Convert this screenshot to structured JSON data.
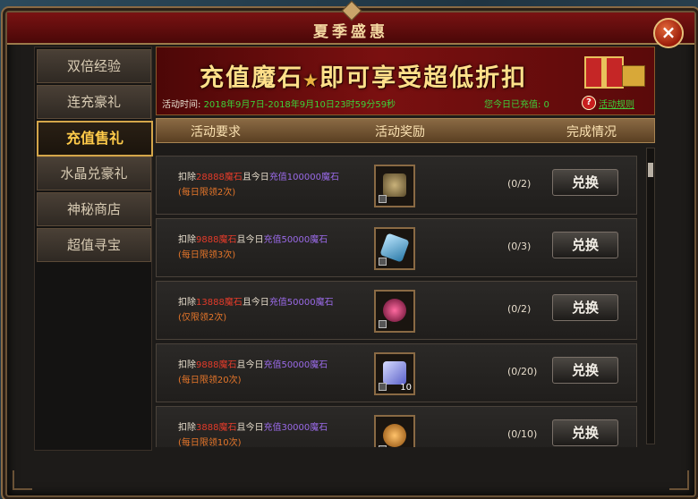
{
  "window": {
    "title": "夏季盛惠",
    "close_icon": "×"
  },
  "sidebar": {
    "items": [
      {
        "label": "双倍经验",
        "active": false
      },
      {
        "label": "连充豪礼",
        "active": false
      },
      {
        "label": "充值售礼",
        "active": true
      },
      {
        "label": "水晶兑豪礼",
        "active": false
      },
      {
        "label": "神秘商店",
        "active": false
      },
      {
        "label": "超值寻宝",
        "active": false
      }
    ]
  },
  "banner": {
    "title_a": "充值魔石",
    "title_b": "即可享受超低折扣",
    "time_label": "活动时间:",
    "time_value": "2018年9月7日-2018年9月10日23时59分59秒",
    "charged_label": "您今日已充值: 0",
    "rule_icon": "?",
    "rule_link": "活动规则"
  },
  "table": {
    "headers": {
      "requirement": "活动要求",
      "reward": "活动奖励",
      "status": "完成情况"
    }
  },
  "rows": [
    {
      "deduct_prefix": "扣除",
      "deduct_amount": "28888魔石",
      "mid": "且今日",
      "charge": "充值100000魔石",
      "limit": "(每日限领2次)",
      "progress": "(0/2)",
      "button": "兑换",
      "qty": "",
      "icon": "chest-icon",
      "icon_color": "#8a7a5a"
    },
    {
      "deduct_prefix": "扣除",
      "deduct_amount": "9888魔石",
      "mid": "且今日",
      "charge": "充值50000魔石",
      "limit": "(每日限领3次)",
      "progress": "(0/3)",
      "button": "兑换",
      "qty": "",
      "icon": "crystal-icon",
      "icon_color": "#5ab0d8"
    },
    {
      "deduct_prefix": "扣除",
      "deduct_amount": "13888魔石",
      "mid": "且今日",
      "charge": "充值50000魔石",
      "limit": "(仅限领2次)",
      "progress": "(0/2)",
      "button": "兑换",
      "qty": "",
      "icon": "orb-icon",
      "icon_color": "#c2205a"
    },
    {
      "deduct_prefix": "扣除",
      "deduct_amount": "9888魔石",
      "mid": "且今日",
      "charge": "充值50000魔石",
      "limit": "(每日限领20次)",
      "progress": "(0/20)",
      "button": "兑换",
      "qty": "10",
      "icon": "giftbox-icon",
      "icon_color": "#9aa0ff"
    },
    {
      "deduct_prefix": "扣除",
      "deduct_amount": "3888魔石",
      "mid": "且今日",
      "charge": "充值30000魔石",
      "limit": "(每日限领10次)",
      "progress": "(0/10)",
      "button": "兑换",
      "qty": "",
      "icon": "amulet-icon",
      "icon_color": "#e0882a"
    }
  ],
  "colors": {
    "accent_gold": "#ffcb4a",
    "deduct_red": "#e33b2a",
    "charge_purple": "#9a6ae8",
    "limit_orange": "#e6762a",
    "green": "#3dd23a"
  }
}
